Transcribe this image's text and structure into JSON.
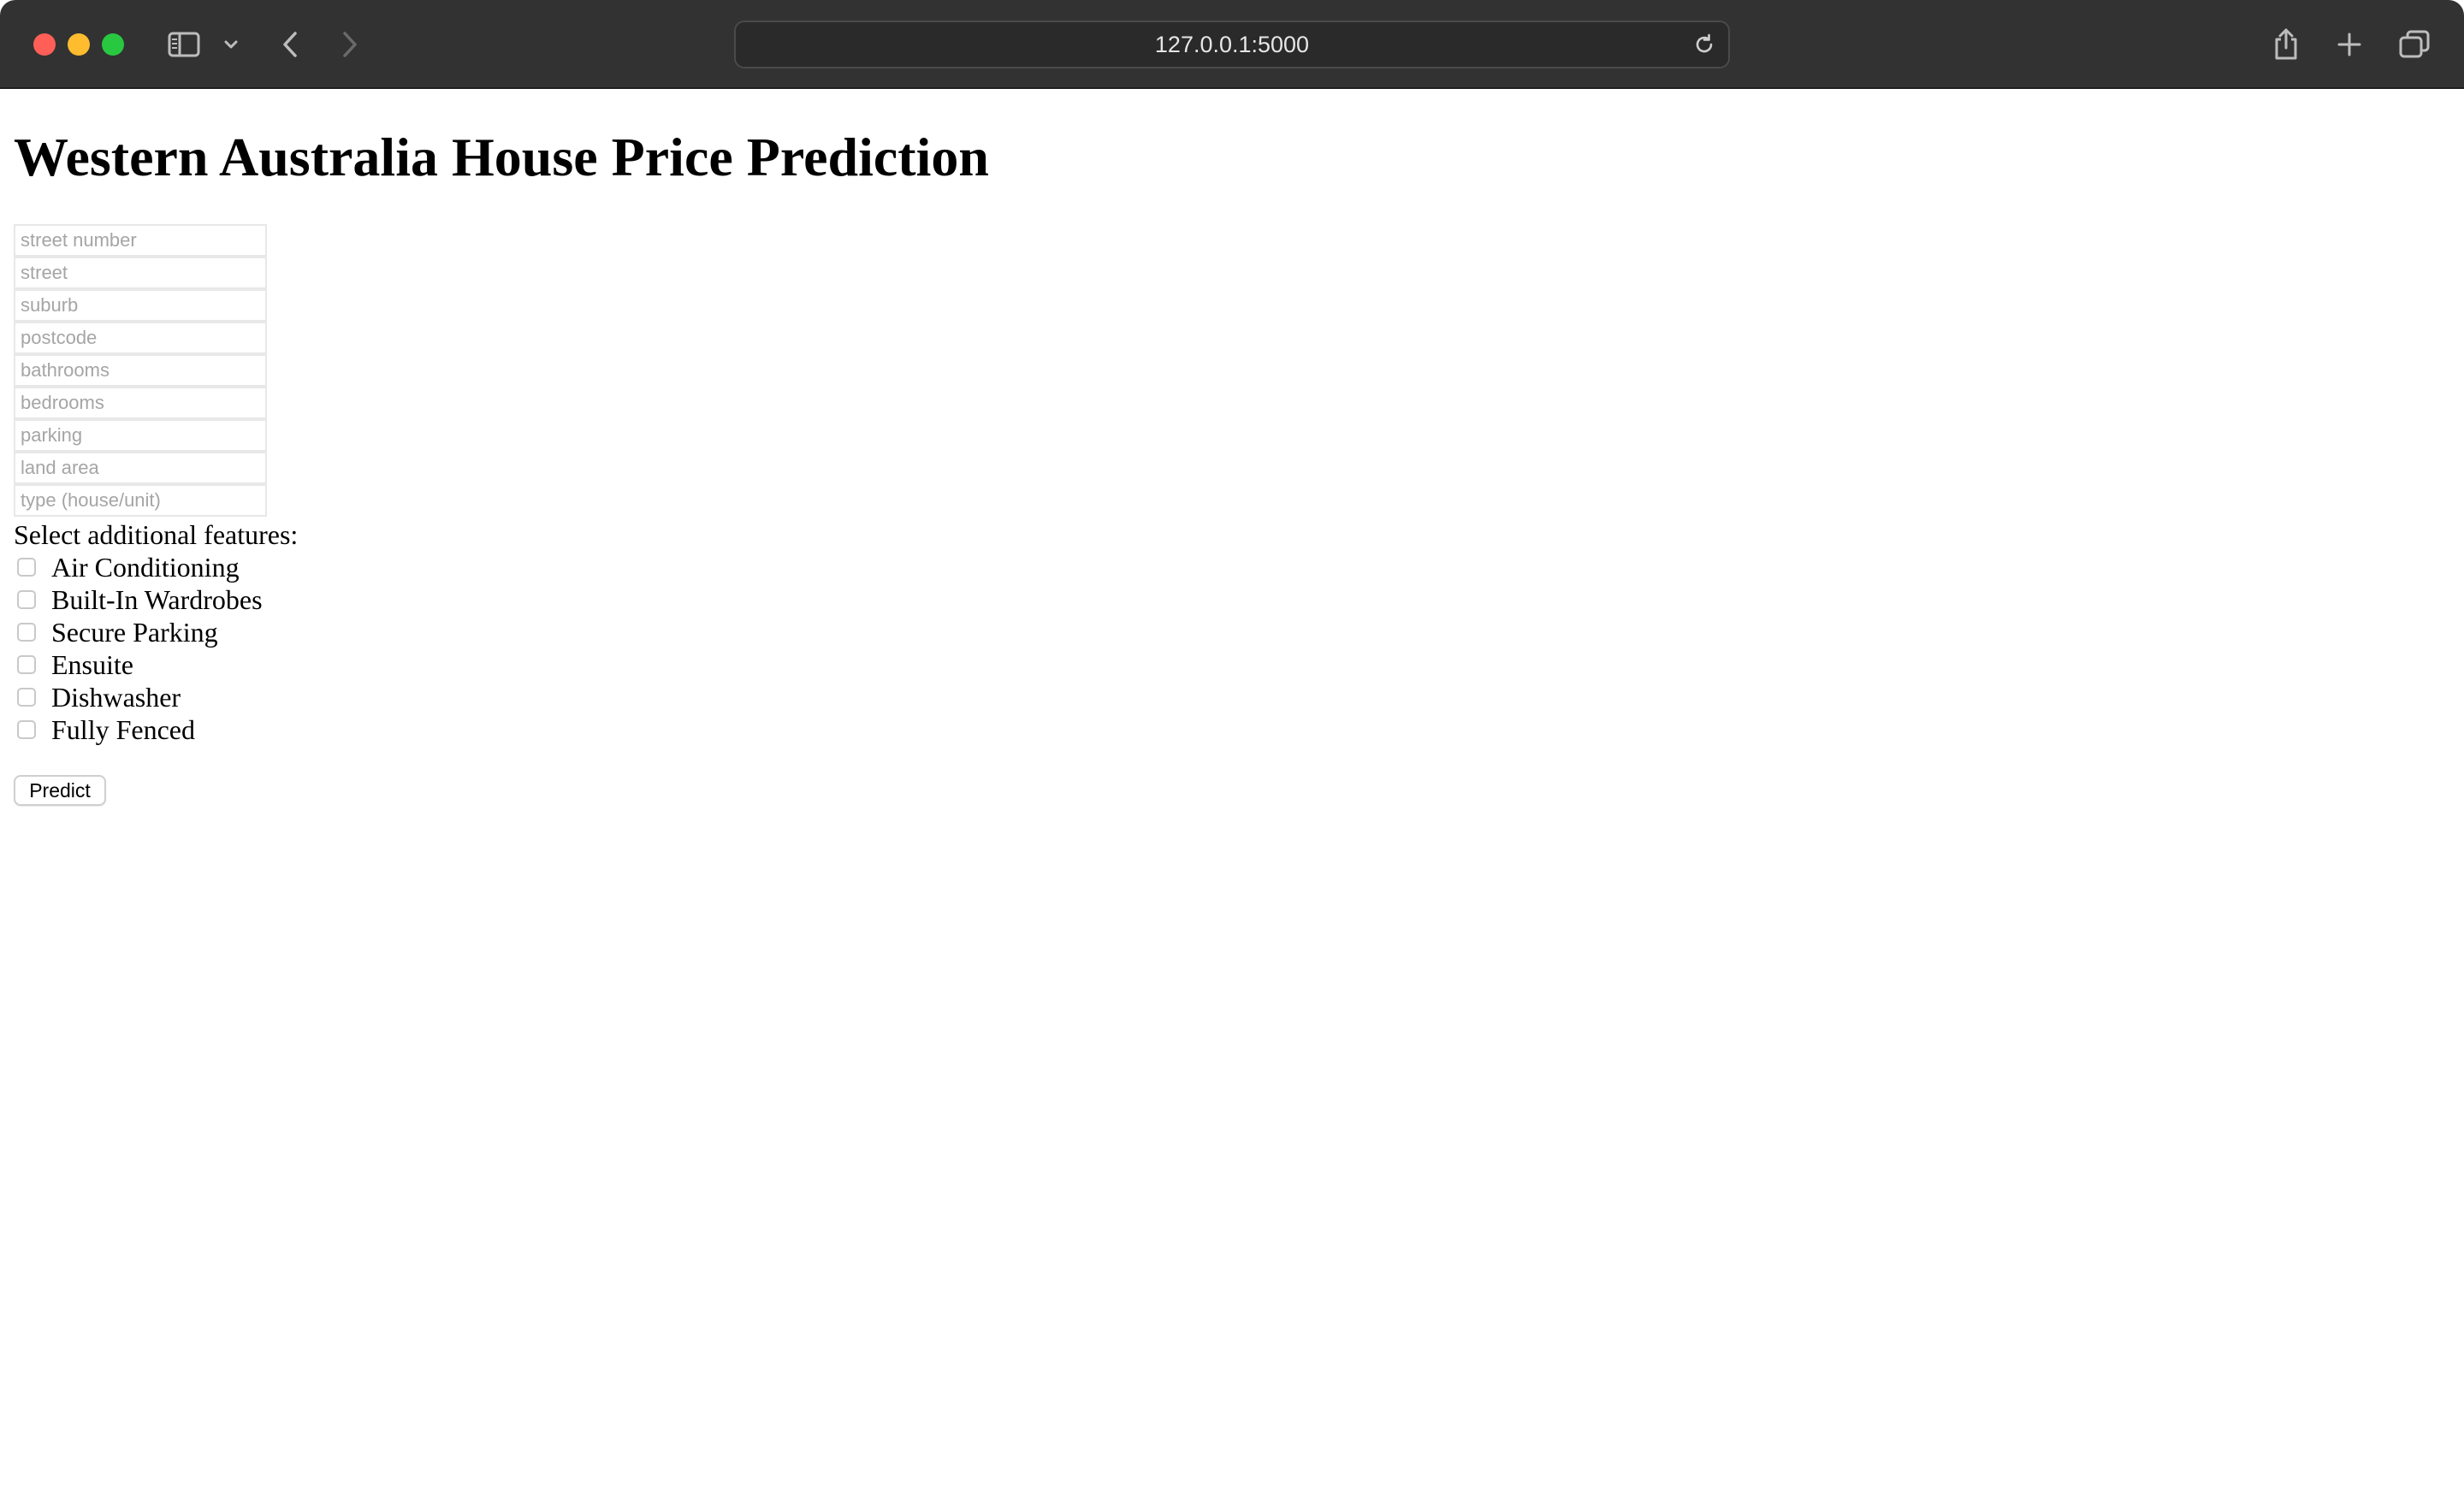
{
  "browser": {
    "url": "127.0.0.1:5000",
    "icons": [
      "sidebar-icon",
      "chevron-down-icon",
      "back-icon",
      "forward-icon",
      "reload-icon",
      "share-icon",
      "plus-icon",
      "tabs-overview-icon"
    ]
  },
  "page": {
    "title": "Western Australia House Price Prediction",
    "fields": [
      {
        "placeholder": "street number",
        "value": ""
      },
      {
        "placeholder": "street",
        "value": ""
      },
      {
        "placeholder": "suburb",
        "value": ""
      },
      {
        "placeholder": "postcode",
        "value": ""
      },
      {
        "placeholder": "bathrooms",
        "value": ""
      },
      {
        "placeholder": "bedrooms",
        "value": ""
      },
      {
        "placeholder": "parking",
        "value": ""
      },
      {
        "placeholder": "land area",
        "value": ""
      },
      {
        "placeholder": "type (house/unit)",
        "value": ""
      }
    ],
    "features_label": "Select additional features:",
    "features": [
      {
        "label": "Air Conditioning",
        "checked": false
      },
      {
        "label": "Built-In Wardrobes",
        "checked": false
      },
      {
        "label": "Secure Parking",
        "checked": false
      },
      {
        "label": "Ensuite",
        "checked": false
      },
      {
        "label": "Dishwasher",
        "checked": false
      },
      {
        "label": "Fully Fenced",
        "checked": false
      }
    ],
    "predict_label": "Predict"
  },
  "colors": {
    "toolbar_bg": "#323232",
    "url_bar_bg": "#2a2a2a",
    "close": "#ff5f57",
    "minimize": "#febc2e",
    "maximize": "#28c840",
    "placeholder_text": "#a5a5a5"
  }
}
